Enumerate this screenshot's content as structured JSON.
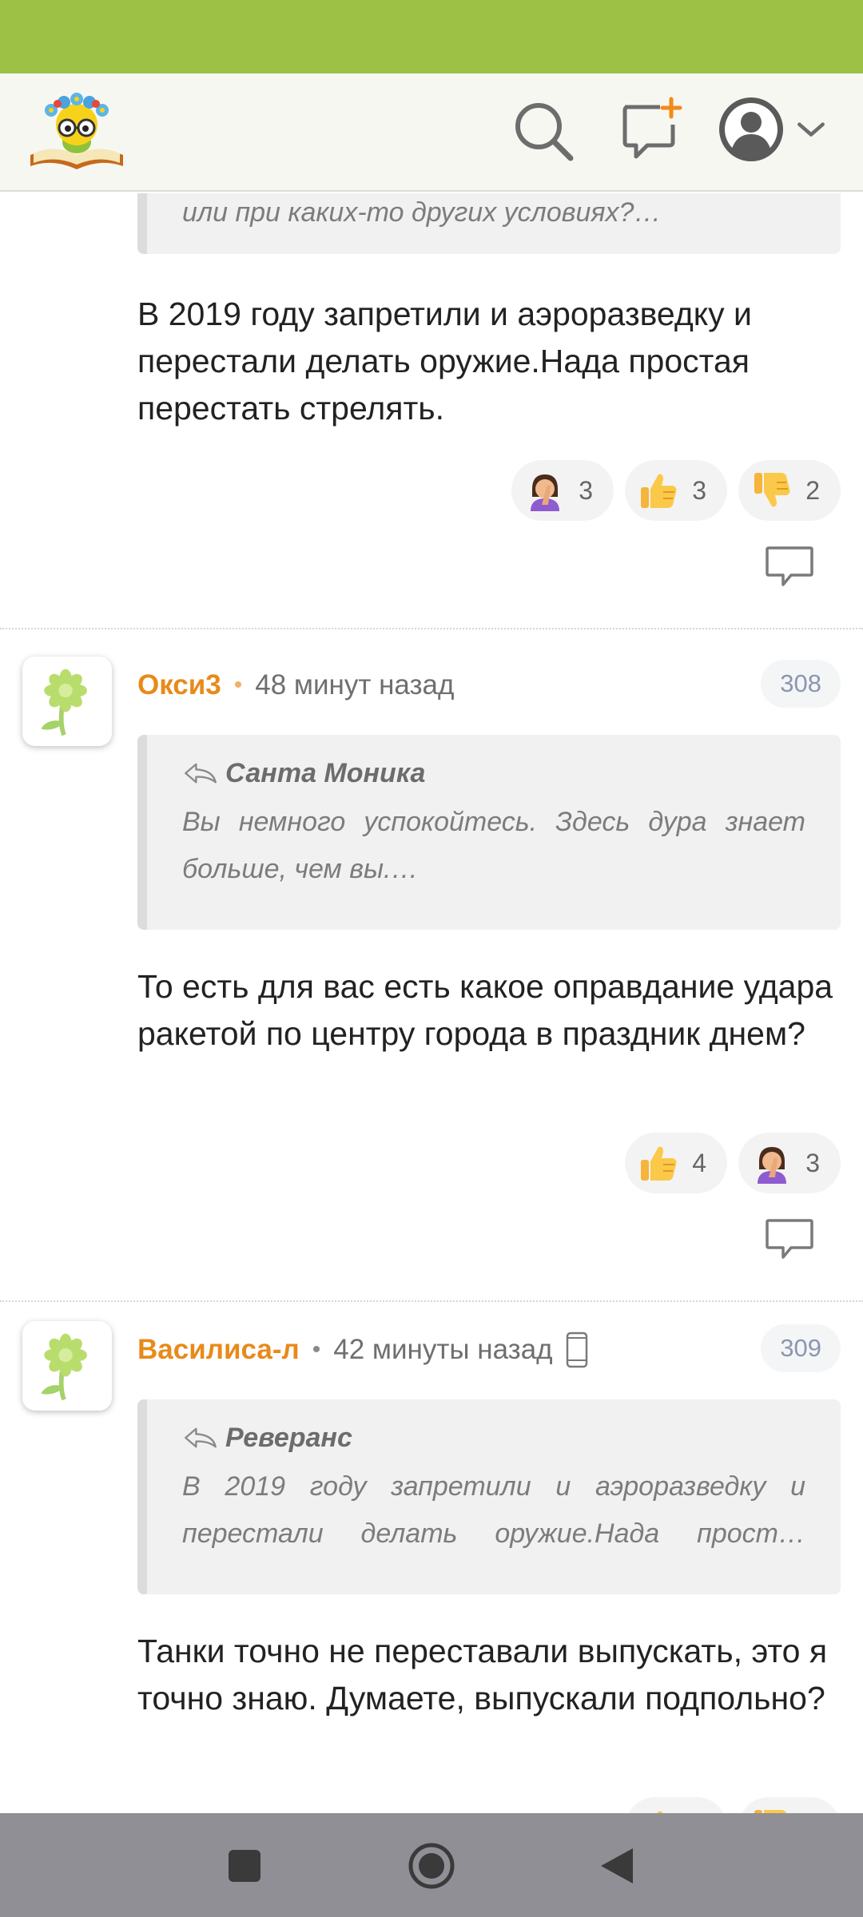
{
  "header": {
    "logo_icon": "logo-kid-reading-book-icon",
    "search_icon": "search-icon",
    "new_message_icon": "new-message-icon",
    "profile_icon": "user-avatar-icon",
    "dropdown_icon": "chevron-down-icon"
  },
  "comments": [
    {
      "quote_text": "или при каких-то других условиях?…",
      "text": "В 2019 году запретили и аэроразведку и перестали делать оружие.Нада простая перестать стрелять.",
      "reactions": [
        {
          "emoji": "face-palm",
          "count": "3"
        },
        {
          "emoji": "thumbs-up",
          "count": "3"
        },
        {
          "emoji": "thumbs-down",
          "count": "2"
        }
      ]
    },
    {
      "author": "Окси3",
      "time": "48 минут назад",
      "number": "308",
      "quote_author": "Санта Моника",
      "quote_text": "Вы немного успокойтесь. Здесь дура знает больше, чем вы.…",
      "text": "То есть для вас есть какое оправдание удара ракетой по центру города в праздник днем?",
      "reactions": [
        {
          "emoji": "thumbs-up",
          "count": "4"
        },
        {
          "emoji": "face-palm",
          "count": "3"
        }
      ]
    },
    {
      "author": "Василиса-л",
      "time": "42 минуты назад",
      "number": "309",
      "quote_author": "Реверанс",
      "quote_text": "В 2019 году запретили и аэроразведку и перестали делать оружие.Нада прост…",
      "text": "Танки точно не переставали выпускать, это я точно знаю. Думаете, выпускали подпольно?"
    }
  ],
  "colors": {
    "status_bar": "#9dc144",
    "username": "#e88a1a",
    "comment_number": "#8b97ad"
  }
}
